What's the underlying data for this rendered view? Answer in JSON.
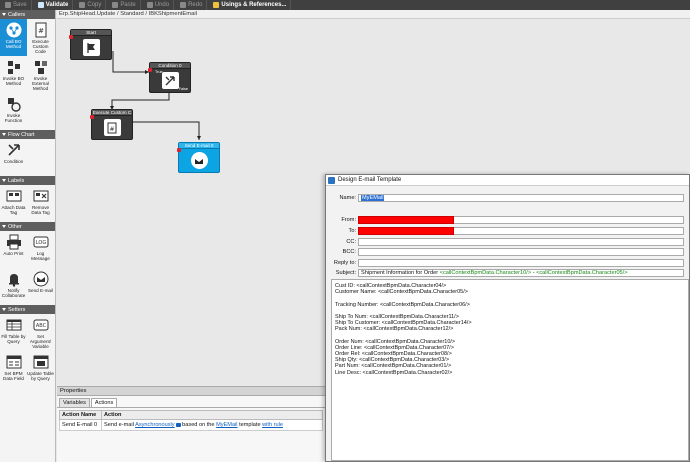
{
  "toolbar": {
    "items": [
      {
        "label": "Save",
        "icon": "save-icon",
        "enabled": false
      },
      {
        "label": "Validate",
        "icon": "validate-icon",
        "enabled": true
      },
      {
        "label": "Copy",
        "icon": "copy-icon",
        "enabled": false
      },
      {
        "label": "Paste",
        "icon": "paste-icon",
        "enabled": false
      },
      {
        "label": "Undo",
        "icon": "undo-icon",
        "enabled": false
      },
      {
        "label": "Redo",
        "icon": "redo-icon",
        "enabled": false
      },
      {
        "label": "Usings & References...",
        "icon": "usings-icon",
        "enabled": true
      }
    ]
  },
  "breadcrumb": "Erp.ShipHead.Update / Standard / IBKShipmentEmail",
  "palette": {
    "sections": [
      {
        "title": "Callers",
        "items": [
          "Call BO Method",
          "Execute Custom Code",
          "Invoke BO Method",
          "Invoke External Method",
          "Invoke Function"
        ]
      },
      {
        "title": "Flow Chart",
        "items": [
          "Condition"
        ]
      },
      {
        "title": "Labels",
        "items": [
          "Attach Data Tag",
          "Remove Data Tag"
        ]
      },
      {
        "title": "Other",
        "items": [
          "Auto Print",
          "Log Message",
          "Notify Collaborate",
          "Send E-mail"
        ]
      },
      {
        "title": "Setters",
        "items": [
          "Fill Table by Query",
          "Set Argument/ Variable",
          "Set BPM Data Field",
          "Update Table by Query"
        ]
      }
    ]
  },
  "canvas": {
    "nodes": [
      {
        "id": "start",
        "title": "Start"
      },
      {
        "id": "condition",
        "title": "Condition 0",
        "true_label": "True",
        "false_label": "False"
      },
      {
        "id": "custom",
        "title": "Execute Custom C"
      },
      {
        "id": "email",
        "title": "Send E-mail 0"
      }
    ]
  },
  "properties": {
    "title": "Properties",
    "tabs": [
      "Variables",
      "Actions"
    ],
    "active_tab": "Actions",
    "columns": [
      "Action Name",
      "Action"
    ],
    "row": {
      "name": "Send E-mail 0",
      "prefix": "Send e-mail",
      "mode": "Asynchronously",
      "middle": "based on the",
      "template": "MyEMail",
      "suffix": "template",
      "rule_link": "with rule"
    }
  },
  "dialog": {
    "title": "Design E-mail Template",
    "name_label": "Name:",
    "name_value": "MyEMail",
    "from_label": "From:",
    "to_label": "To:",
    "cc_label": "CC:",
    "bcc_label": "BCC:",
    "reply_label": "Reply to:",
    "subject_label": "Subject:",
    "subject_text": "Shipment Information for Order",
    "subject_var1": "<callContextBpmData.Character10/>",
    "subject_sep": " - ",
    "subject_var2": "<callContextBpmData.Character05/>",
    "body": [
      "Cust ID: <callContextBpmData.Character04/>",
      "Customer Name: <callContextBpmData.Character05/>",
      "",
      "Tracking Number: <callContextBpmData.Character06/>",
      "",
      "Ship To Num: <callContextBpmData.Character11/>",
      "Ship To Customer: <callContextBpmData.Character14/>",
      "Pack Num: <callContextBpmData.Character12/>",
      "",
      "Order Num: <callContextBpmData.Character10/>",
      "Order Line: <callContextBpmData.Character07/>",
      "Order Rel: <callContextBpmData.Character08/>",
      "Ship Qty: <callContextBpmData.Character03/>",
      "Part Num: <callContextBpmData.Character01/>",
      "Line Desc: <callContextBpmData.Character02/>"
    ]
  },
  "colors": {
    "accent": "#1b8fd6",
    "redacted": "#ff0000",
    "variable": "#1a8a1a"
  }
}
